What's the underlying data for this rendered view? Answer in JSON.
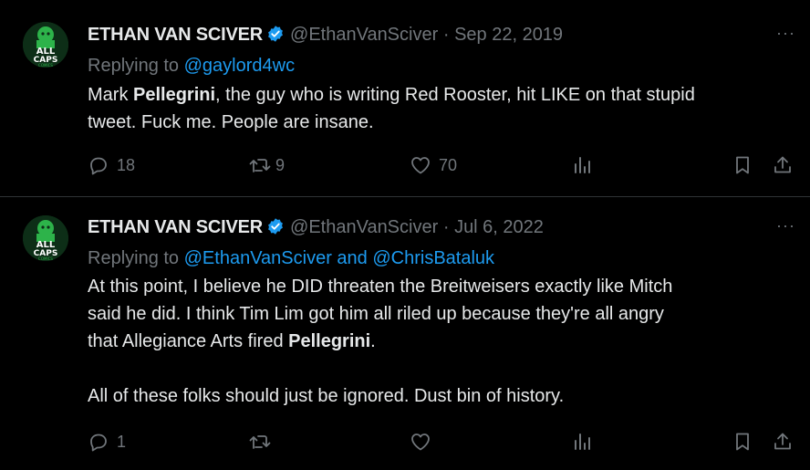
{
  "tweets": [
    {
      "display_name": "ETHAN VAN SCIVER",
      "handle": "@EthanVanSciver",
      "separator": "·",
      "date": "Sep 22, 2019",
      "replying_prefix": "Replying to",
      "replying_to": "@gaylord4wc",
      "body_lines": [
        {
          "before": "Mark ",
          "bold": "Pellegrini",
          "after": ", the guy who is writing Red Rooster, hit LIKE on that stupid"
        },
        {
          "before": "tweet.  Fuck me.  People are insane.",
          "bold": "",
          "after": ""
        }
      ],
      "replies": "18",
      "retweets": "9",
      "likes": "70",
      "more": "···"
    },
    {
      "display_name": "ETHAN VAN SCIVER",
      "handle": "@EthanVanSciver",
      "separator": "·",
      "date": "Jul 6, 2022",
      "replying_prefix": "Replying to",
      "replying_to": "@EthanVanSciver and @ChrisBataluk",
      "body_lines": [
        {
          "before": "At this point, I believe he DID threaten the Breitweisers exactly like Mitch",
          "bold": "",
          "after": ""
        },
        {
          "before": "said he did.  I think Tim Lim got him all riled up because they're all angry",
          "bold": "",
          "after": ""
        },
        {
          "before": "that Allegiance Arts fired ",
          "bold": "Pellegrini",
          "after": "."
        },
        {
          "before": "",
          "bold": "",
          "after": ""
        },
        {
          "before": "All of these folks should just be ignored.  Dust bin of history.",
          "bold": "",
          "after": ""
        }
      ],
      "replies": "1",
      "retweets": "",
      "likes": "",
      "more": "···"
    }
  ],
  "avatar_text": {
    "line1": "ALL",
    "line2": "CAPS",
    "line3": "COMICS"
  },
  "icons": {
    "verified": "verified-badge-icon",
    "reply": "reply-icon",
    "retweet": "retweet-icon",
    "like": "heart-icon",
    "views": "views-chart-icon",
    "bookmark": "bookmark-icon",
    "share": "share-icon",
    "more": "more-icon"
  },
  "colors": {
    "background": "#000000",
    "text": "#e7e9ea",
    "muted": "#71767b",
    "link": "#1d9bf0",
    "divider": "#2f3336",
    "avatar_green": "#2db34a"
  }
}
